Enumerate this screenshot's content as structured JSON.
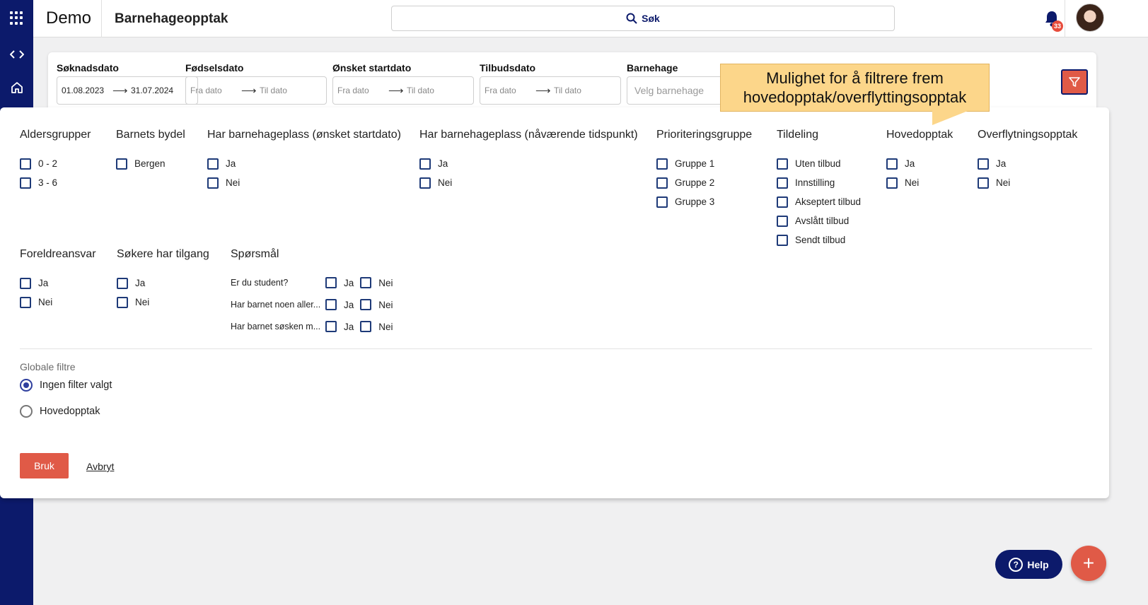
{
  "header": {
    "brand": "Demo",
    "page_title": "Barnehageopptak",
    "search_label": "Søk",
    "notification_count": "33"
  },
  "icons": {
    "apps": "grid-icon",
    "code": "code-icon",
    "home": "home-icon",
    "search": "search-icon",
    "bell": "bell-icon",
    "filter": "filter-icon",
    "help": "help-icon",
    "add": "plus-icon"
  },
  "date_filters": [
    {
      "label": "Søknadsdato",
      "from": "01.08.2023",
      "to": "31.07.2024"
    },
    {
      "label": "Fødselsdato",
      "from": "Fra dato",
      "to": "Til dato"
    },
    {
      "label": "Ønsket startdato",
      "from": "Fra dato",
      "to": "Til dato"
    },
    {
      "label": "Tilbudsdato",
      "from": "Fra dato",
      "to": "Til dato"
    }
  ],
  "kindergarten": {
    "label": "Barnehage",
    "placeholder": "Velg barnehage"
  },
  "tooltip": {
    "line1": "Mulighet for å filtrere frem",
    "line2": "hovedopptak/overflyttingsopptak"
  },
  "groups": {
    "aldersgrupper": {
      "title": "Aldersgrupper",
      "options": [
        "0 - 2",
        "3 - 6"
      ]
    },
    "bydel": {
      "title": "Barnets bydel",
      "options": [
        "Bergen"
      ]
    },
    "plass_onsket": {
      "title": "Har barnehageplass (ønsket startdato)",
      "options": [
        "Ja",
        "Nei"
      ]
    },
    "plass_naa": {
      "title": "Har barnehageplass (nåværende tidspunkt)",
      "options": [
        "Ja",
        "Nei"
      ]
    },
    "prioritet": {
      "title": "Prioriteringsgruppe",
      "options": [
        "Gruppe 1",
        "Gruppe 2",
        "Gruppe 3"
      ]
    },
    "tildeling": {
      "title": "Tildeling",
      "options": [
        "Uten tilbud",
        "Innstilling",
        "Akseptert tilbud",
        "Avslått tilbud",
        "Sendt tilbud"
      ]
    },
    "hovedopptak": {
      "title": "Hovedopptak",
      "options": [
        "Ja",
        "Nei"
      ]
    },
    "overflytning": {
      "title": "Overflytningsopptak",
      "options": [
        "Ja",
        "Nei"
      ]
    },
    "foreldreansvar": {
      "title": "Foreldreansvar",
      "options": [
        "Ja",
        "Nei"
      ]
    },
    "tilgang": {
      "title": "Søkere har tilgang",
      "options": [
        "Ja",
        "Nei"
      ]
    },
    "sporsmal": {
      "title": "Spørsmål",
      "questions": [
        "Er du student?",
        "Har barnet noen aller...",
        "Har barnet søsken m..."
      ],
      "yes": "Ja",
      "no": "Nei"
    }
  },
  "global_filters": {
    "label": "Globale filtre",
    "options": [
      "Ingen filter valgt",
      "Hovedopptak"
    ],
    "selected": "Ingen filter valgt"
  },
  "actions": {
    "apply": "Bruk",
    "cancel": "Avbryt"
  },
  "help_label": "Help",
  "colors": {
    "navy": "#0c1a6b",
    "accent": "#e05a47",
    "tooltip": "#fcd68a"
  }
}
